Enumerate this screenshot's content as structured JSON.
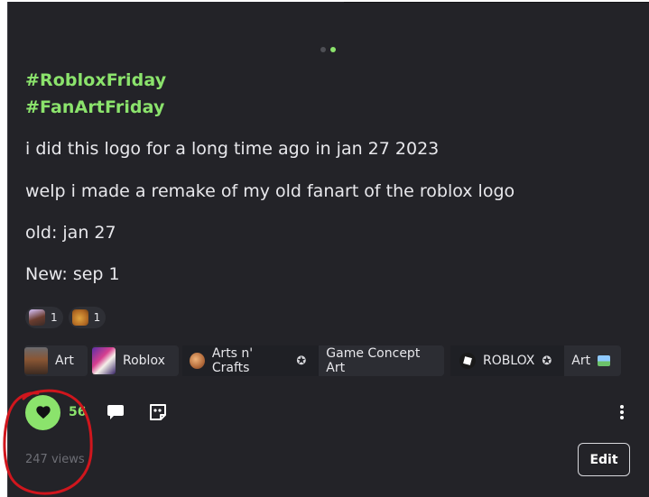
{
  "carousel": {
    "pages": 2,
    "active_index": 1
  },
  "post": {
    "hashtags": [
      "#RobloxFriday",
      "#FanArtFriday"
    ],
    "paragraphs": [
      "i did this logo for a long time ago in jan 27 2023",
      "welp i made a remake of my old fanart of the roblox logo",
      "old: jan 27",
      "New: sep 1"
    ]
  },
  "reactions": [
    {
      "emoji": "character-emoji",
      "count": "1"
    },
    {
      "emoji": "bread-emoji",
      "count": "1"
    }
  ],
  "tags": [
    {
      "type": "community",
      "label": "Art"
    },
    {
      "type": "community",
      "label": "Roblox"
    },
    {
      "type": "group",
      "label": "Arts n' Crafts",
      "verified": true,
      "topic": "Game Concept Art"
    },
    {
      "type": "group",
      "label": "ROBLOX",
      "verified": true,
      "topic": "Art"
    }
  ],
  "actions": {
    "like_count": "56",
    "liked": true,
    "views": "247 views",
    "edit_label": "Edit",
    "icons": [
      "heart-icon",
      "comment-icon",
      "share-icon",
      "more-vertical-icon"
    ]
  },
  "colors": {
    "background": "#232328",
    "accent": "#8be36c",
    "text": "#e8e8ec",
    "muted": "#6d6e75",
    "annotation": "#d0161d"
  }
}
